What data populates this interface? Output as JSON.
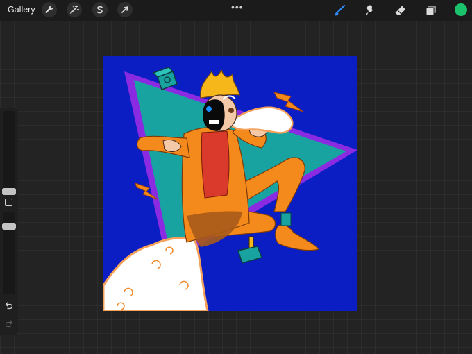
{
  "topbar": {
    "gallery_label": "Gallery",
    "left_tools": [
      {
        "name": "wrench-icon",
        "role": "actions"
      },
      {
        "name": "magic-wand-icon",
        "role": "adjustments"
      },
      {
        "name": "selection-s-icon",
        "role": "selection"
      },
      {
        "name": "arrow-cursor-icon",
        "role": "transform"
      }
    ],
    "more_label": "•••",
    "right_tools": [
      {
        "name": "brush-icon",
        "role": "paint",
        "active": true
      },
      {
        "name": "smudge-icon",
        "role": "smudge"
      },
      {
        "name": "eraser-icon",
        "role": "erase"
      },
      {
        "name": "layers-icon",
        "role": "layers"
      }
    ],
    "current_color": "#1bc36c"
  },
  "sidebar": {
    "brush_size_level": 0.32,
    "opacity_level": 0.12,
    "icons": [
      "square-modify-icon",
      "undo-icon",
      "redo-icon"
    ]
  },
  "canvas": {
    "background_color": "#0a1ec4",
    "accent_colors": {
      "triangle_fill": "#19a3a0",
      "triangle_border": "#8a2be2",
      "jacket": "#f58a1c",
      "shirt": "#d93a2b",
      "hair": "#f6b71a",
      "smoke": "#ffffff",
      "cube": "#19a3a0"
    }
  }
}
